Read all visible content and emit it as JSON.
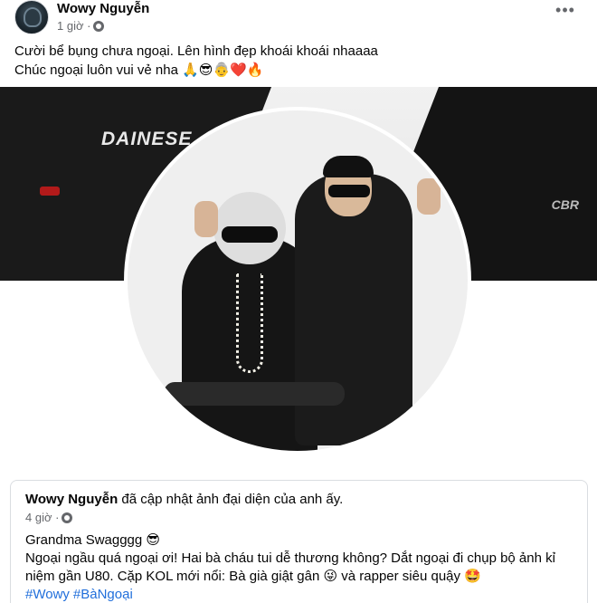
{
  "post": {
    "author": "Wowy Nguyễn",
    "time": "1 giờ ·",
    "caption_line1": "Cười bể bụng chưa ngoại. Lên hình đẹp khoái khoái nhaaaa",
    "caption_line2": "Chúc ngoại luôn vui vẻ nha 🙏😎👵❤️🔥",
    "more_label": "•••"
  },
  "cover": {
    "brand_text": "DAINESE",
    "bike_text": "CBR"
  },
  "shared": {
    "author": "Wowy Nguyễn",
    "action": " đã cập nhật ảnh đại diện của anh ấy.",
    "time": "4 giờ ·",
    "line1": "Grandma Swagggg 😎",
    "line2": "Ngoại ngầu quá ngoại ơi! Hai bà cháu tui dễ thương không? Dắt ngoại đi chụp bộ ảnh kỉ",
    "line3": "niệm gần U80. Cặp KOL mới nổi: Bà già giật gân 😜 và rapper siêu quậy 🤩",
    "hashtag1": "#Wowy",
    "hashtag2": "#BàNgoại"
  }
}
